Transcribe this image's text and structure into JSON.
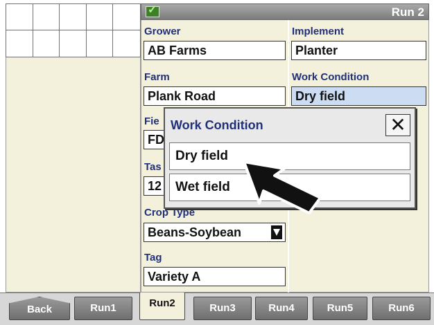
{
  "header": {
    "status_icon": "checkmark-icon",
    "status_glyph": "✓",
    "run_title": "Run 2"
  },
  "fields": {
    "grower": {
      "label": "Grower",
      "value": "AB Farms"
    },
    "implement": {
      "label": "Implement",
      "value": "Planter"
    },
    "farm": {
      "label": "Farm",
      "value": "Plank Road"
    },
    "work_condition": {
      "label": "Work Condition",
      "value": "Dry field"
    },
    "field": {
      "label": "Fie",
      "value": "FD"
    },
    "task": {
      "label": "Tas",
      "value": "12"
    },
    "crop_type": {
      "label": "Crop Type",
      "value": "Beans-Soybean"
    },
    "tag": {
      "label": "Tag",
      "value": "Variety A"
    }
  },
  "popup": {
    "title": "Work Condition",
    "close_glyph": "✕",
    "options": [
      "Dry field",
      "Wet field"
    ]
  },
  "tabs": {
    "items": [
      "Back",
      "Run1",
      "Run2",
      "Run3",
      "Run4",
      "Run5",
      "Run6"
    ],
    "active": "Run2"
  },
  "colors": {
    "panel_bg": "#f3f0db",
    "label_blue": "#203078",
    "selected_field": "#ccdcf2",
    "header_gray": "#8a8a8a"
  }
}
